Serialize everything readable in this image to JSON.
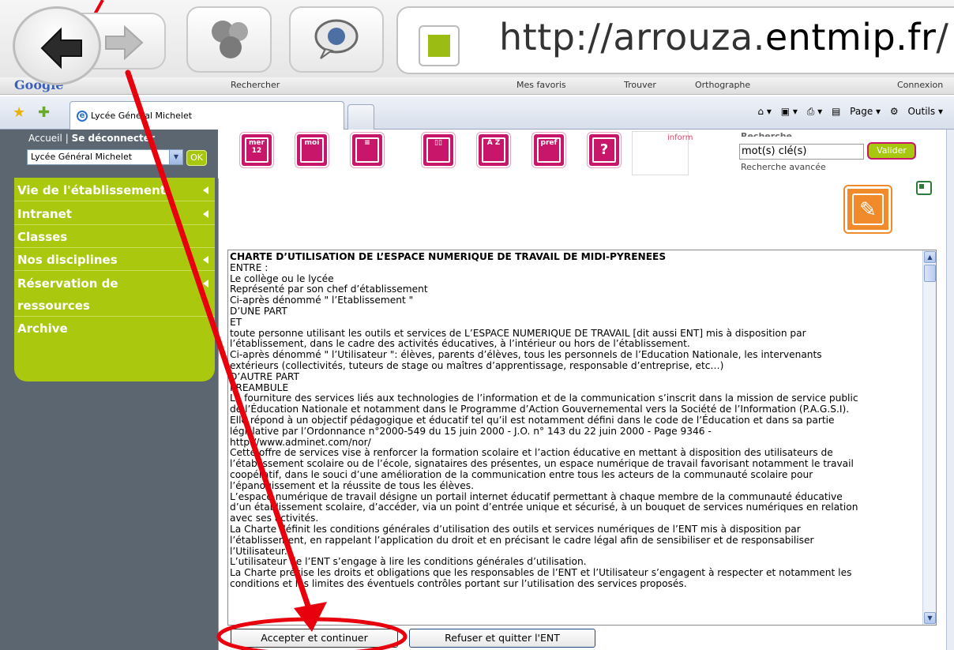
{
  "browser": {
    "url_prefix": "http://arrouza.",
    "url_domain": "entmip.fr",
    "url_suffix": "/",
    "tab_title": "Lycée Général Michelet",
    "google_label": "Google",
    "toolbar_items": [
      "Rechercher",
      "Mes favoris",
      "Trouver",
      "Orthographe",
      "Connexion"
    ],
    "page_menu": "Page",
    "tools_menu": "Outils"
  },
  "sidebar": {
    "home": "Accueil",
    "separator": "|",
    "logout": "Se déconnecter",
    "school_select": "Lycée Général Michelet",
    "ok_label": "OK",
    "menu": [
      {
        "label": "Vie de l'établissement"
      },
      {
        "label": "Intranet"
      },
      {
        "label": "Classes"
      },
      {
        "label": "Nos disciplines"
      },
      {
        "label": "Réservation de"
      },
      {
        "label": "ressources"
      },
      {
        "label": "Archive"
      }
    ]
  },
  "header": {
    "icons": [
      {
        "name": "calendar-icon",
        "text": "mer 12"
      },
      {
        "name": "mail-icon",
        "text": "moi"
      },
      {
        "name": "document-icon",
        "text": ""
      },
      {
        "name": "binders-icon",
        "text": ""
      },
      {
        "name": "directory-icon",
        "text": "A Z"
      },
      {
        "name": "preferences-icon",
        "text": "pref"
      },
      {
        "name": "help-icon",
        "text": "?"
      }
    ],
    "inform": "inform",
    "search_heading": "Recherche",
    "search_value": "mot(s) clé(s)",
    "search_button": "Valider",
    "advanced_search": "Recherche avancée"
  },
  "charter": {
    "title": "CHARTE D’UTILISATION DE L’ESPACE NUMERIQUE DE TRAVAIL DE MIDI-PYRENEES",
    "lines": [
      "ENTRE :",
      "Le collège ou le lycée",
      "Représenté par son chef d’établissement",
      "Ci-après dénommé \" l’Etablissement \"",
      "D’UNE PART",
      "ET",
      "toute personne utilisant les outils et services de L’ESPACE NUMERIQUE DE TRAVAIL [dit aussi ENT] mis à disposition par",
      "l’établissement, dans le cadre des activités éducatives, à l’intérieur ou hors de l’établissement.",
      "Ci-après dénommé \" l’Utilisateur \": élèves, parents d’élèves, tous les personnels de l’Education Nationale, les intervenants",
      "extérieurs (collectivités, tuteurs de stage ou maîtres d’apprentissage, responsable d’entreprise, etc…)",
      "D’AUTRE PART",
      "PREAMBULE",
      "La fourniture des services liés aux technologies de l’information et de la communication s’inscrit dans la mission de service public",
      "de l’Éducation Nationale et notamment dans le Programme d’Action Gouvernemental vers la Société de l’Information (P.A.G.S.I).",
      "Elle répond à un objectif pédagogique et éducatif tel qu’il est notamment défini dans le code de l’Éducation et dans sa partie",
      "législative par l’Ordonnance n°2000-549 du 15 juin 2000 - J.O. n° 143 du 22 juin 2000 - Page 9346 -",
      "http://www.adminet.com/nor/",
      "Cette offre de services vise à renforcer la formation scolaire et l’action éducative en mettant à disposition des utilisateurs de",
      "l’établissement scolaire ou de l’école, signataires des présentes, un espace numérique de travail favorisant notamment le travail",
      "coopératif, dans le souci d’une amélioration de la communication entre tous les acteurs de la communauté scolaire pour",
      "l’épanouissement et la réussite de tous les élèves.",
      "L’espace numérique de travail désigne un portail internet éducatif permettant à chaque membre de la communauté éducative",
      "d’un établissement scolaire, d’accéder, via un point d’entrée unique et sécurisé, à un bouquet de services numériques en relation",
      "avec ses activités.",
      "La Charte définit les conditions générales d’utilisation des outils et services numériques de l’ENT mis à disposition par",
      "l’établissement, en rappelant l’application du droit et en précisant le cadre légal afin de sensibiliser et de responsabiliser",
      "l’Utilisateur.",
      "L’utilisateur de l’ENT s’engage à lire les conditions générales d’utilisation.",
      "La Charte précise les droits et obligations que les responsables de l’ENT et l’Utilisateur s’engagent à respecter et notamment les",
      "conditions et les limites des éventuels contrôles portant sur l’utilisation des services proposés."
    ]
  },
  "actions": {
    "accept": "Accepter et continuer",
    "refuse": "Refuser et quitter l'ENT"
  },
  "colors": {
    "accent_green": "#a9c80e",
    "magenta": "#c8166b",
    "annotation_red": "#e8000d",
    "sidebar_bg": "#5b6671"
  }
}
